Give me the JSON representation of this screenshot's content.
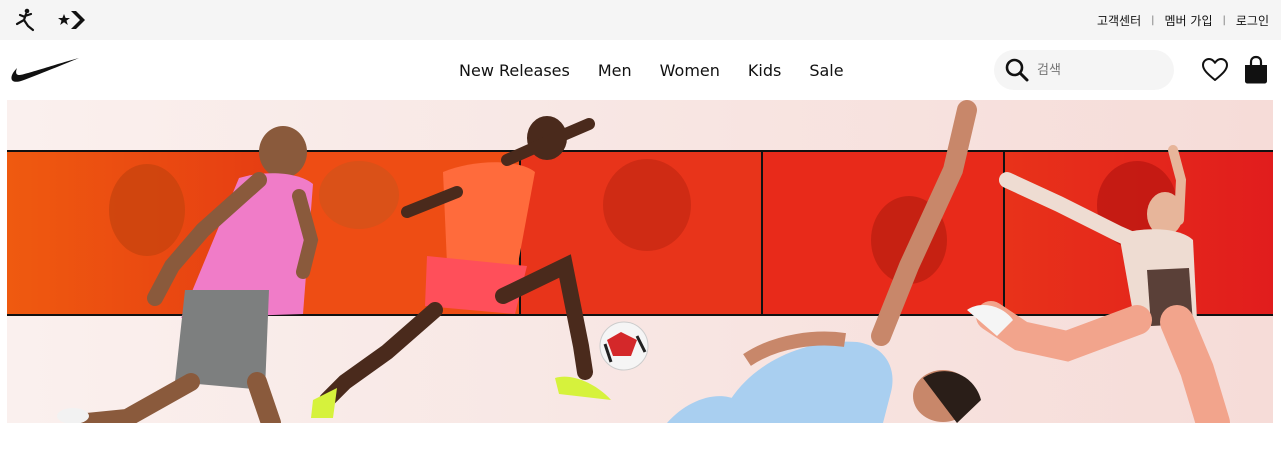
{
  "util_bar": {
    "brand_icons": [
      "jordan-jumpman-icon",
      "converse-star-chevron-icon"
    ],
    "links": [
      {
        "label": "고객센터"
      },
      {
        "label": "멤버 가입"
      },
      {
        "label": "로그인"
      }
    ],
    "separator": "|"
  },
  "nav": {
    "logo_icon": "nike-swoosh-logo",
    "links": [
      {
        "label": "New Releases"
      },
      {
        "label": "Men"
      },
      {
        "label": "Women"
      },
      {
        "label": "Kids"
      },
      {
        "label": "Sale"
      }
    ],
    "search": {
      "placeholder": "검색",
      "icon": "search-icon"
    },
    "favorites_icon": "heart-icon",
    "bag_icon": "shopping-bag-icon"
  },
  "hero": {
    "image": "athletes-running-kicking-dancing-red-panel-banner",
    "colors": {
      "panel_red": "#e8281c",
      "panel_orange": "#f25a12",
      "background": "#f8e6e3"
    }
  }
}
